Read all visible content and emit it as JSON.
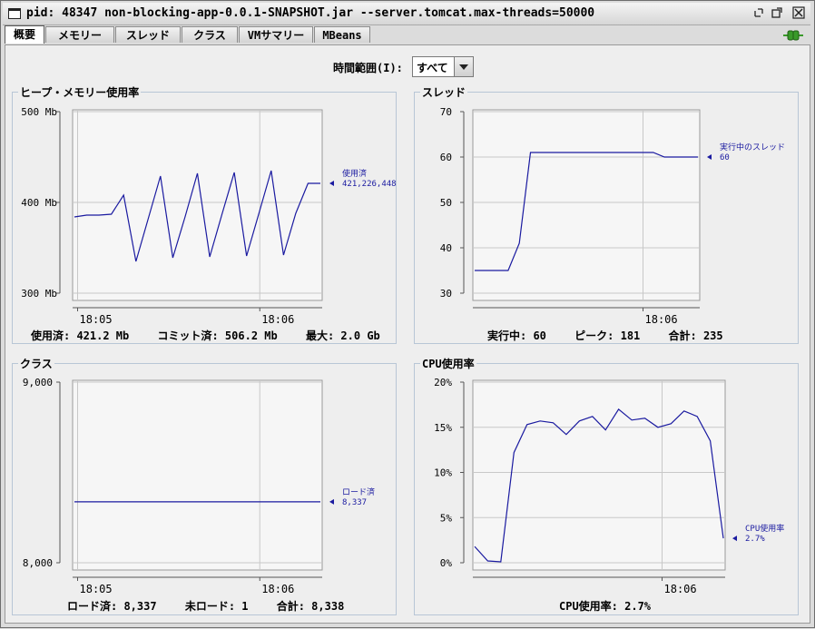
{
  "window": {
    "title": "pid: 48347 non-blocking-app-0.0.1-SNAPSHOT.jar --server.tomcat.max-threads=50000"
  },
  "tabs": [
    {
      "label": "概要",
      "active": true
    },
    {
      "label": "メモリー",
      "active": false
    },
    {
      "label": "スレッド",
      "active": false
    },
    {
      "label": "クラス",
      "active": false
    },
    {
      "label": "VMサマリー",
      "active": false
    },
    {
      "label": "MBeans",
      "active": false
    }
  ],
  "time_range": {
    "label": "時間範囲(I):",
    "value": "すべて"
  },
  "panels": {
    "heap": {
      "title": "ヒープ・メモリー使用率",
      "stats": [
        {
          "label": "使用済: 421.2 Mb"
        },
        {
          "label": "コミット済: 506.2 Mb"
        },
        {
          "label": "最大: 2.0 Gb"
        }
      ]
    },
    "threads": {
      "title": "スレッド",
      "stats": [
        {
          "label": "実行中: 60"
        },
        {
          "label": "ピーク: 181"
        },
        {
          "label": "合計: 235"
        }
      ]
    },
    "classes": {
      "title": "クラス",
      "stats": [
        {
          "label": "ロード済: 8,337"
        },
        {
          "label": "未ロード: 1"
        },
        {
          "label": "合計: 8,338"
        }
      ]
    },
    "cpu": {
      "title": "CPU使用率",
      "stats": [
        {
          "label": "CPU使用率: 2.7%"
        }
      ]
    }
  },
  "chart_data": [
    {
      "id": "heap",
      "type": "line",
      "yticks": [
        "500 Mb",
        "400 Mb",
        "300 Mb"
      ],
      "ylim": [
        300,
        500
      ],
      "xticks": [
        "18:05",
        "18:06"
      ],
      "xtick_pos": [
        0.02,
        0.75
      ],
      "series": [
        {
          "name": "使用済",
          "value_label": "421,226,448",
          "values": [
            384,
            386,
            386,
            387,
            408,
            335,
            382,
            429,
            339,
            384,
            432,
            340,
            387,
            433,
            341,
            388,
            435,
            342,
            388,
            421,
            421
          ]
        }
      ]
    },
    {
      "id": "threads",
      "type": "line",
      "yticks": [
        "70",
        "60",
        "50",
        "40",
        "30"
      ],
      "ylim": [
        30,
        70
      ],
      "xticks": [
        "18:06"
      ],
      "xtick_pos": [
        0.75
      ],
      "series": [
        {
          "name": "実行中のスレッド",
          "value_label": "60",
          "values": [
            35,
            35,
            35,
            35,
            41,
            61,
            61,
            61,
            61,
            61,
            61,
            61,
            61,
            61,
            61,
            61,
            61,
            60,
            60,
            60,
            60
          ]
        }
      ]
    },
    {
      "id": "classes",
      "type": "line",
      "yticks": [
        "9,000",
        "8,000"
      ],
      "ylim": [
        8000,
        9000
      ],
      "xticks": [
        "18:05",
        "18:06"
      ],
      "xtick_pos": [
        0.02,
        0.75
      ],
      "series": [
        {
          "name": "ロード済",
          "value_label": "8,337",
          "values": [
            8337,
            8337,
            8337,
            8337,
            8337,
            8337,
            8337,
            8337,
            8337,
            8337,
            8337,
            8337,
            8337,
            8337,
            8337,
            8337,
            8337,
            8337,
            8337,
            8337,
            8337
          ]
        }
      ]
    },
    {
      "id": "cpu",
      "type": "line",
      "yticks": [
        "20%",
        "15%",
        "10%",
        "5%",
        "0%"
      ],
      "ylim": [
        0,
        20
      ],
      "xticks": [
        "18:06"
      ],
      "xtick_pos": [
        0.75
      ],
      "series": [
        {
          "name": "CPU使用率",
          "value_label": "2.7%",
          "values": [
            1.8,
            0.2,
            0.1,
            12.2,
            15.3,
            15.7,
            15.5,
            14.2,
            15.7,
            16.2,
            14.7,
            17.0,
            15.8,
            16.0,
            15.0,
            15.4,
            16.8,
            16.2,
            13.5,
            2.7
          ]
        }
      ]
    }
  ],
  "colors": {
    "series": "#1a1aa0",
    "grid": "#c8c8c8",
    "plot_bg": "#f6f6f6",
    "accent_green": "#3a9a2a"
  }
}
